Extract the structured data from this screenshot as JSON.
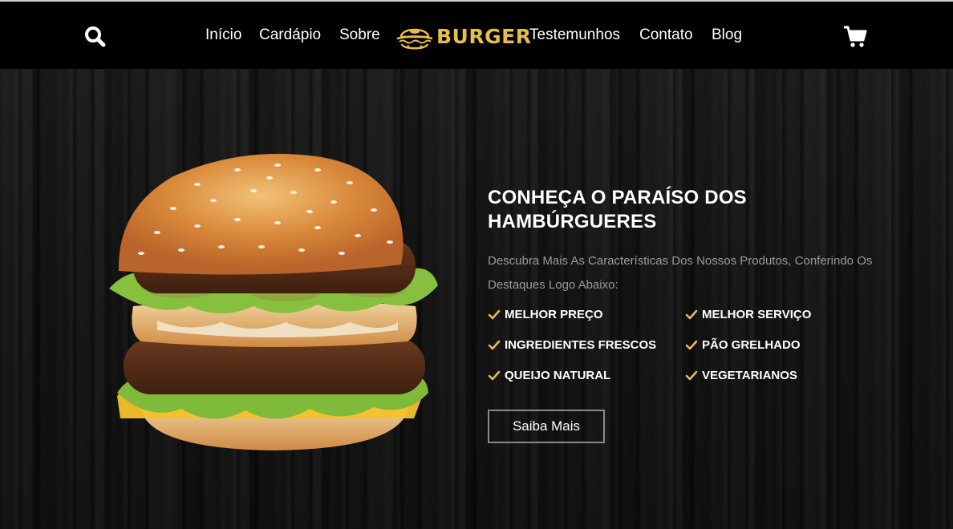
{
  "nav": {
    "links": [
      "Início",
      "Cardápio",
      "Sobre",
      "Testemunhos",
      "Contato",
      "Blog"
    ],
    "logo_text": "BURGER",
    "search_icon": "search-icon",
    "cart_icon": "cart-icon"
  },
  "hero": {
    "title_line1": "CONHEÇA O PARAÍSO DOS",
    "title_line2": "HAMBÚRGUERES",
    "description": "Descubra Mais As Características Dos Nossos Produtos, Conferindo Os Destaques Logo Abaixo:",
    "features": [
      "MELHOR PREÇO",
      "MELHOR SERVIÇO",
      "INGREDIENTES FRESCOS",
      "PÃO GRELHADO",
      "QUEIJO NATURAL",
      "VEGETARIANOS"
    ],
    "cta_label": "Saiba Mais"
  },
  "colors": {
    "accent": "#e8bc4a",
    "background": "#000000",
    "text": "#ffffff"
  }
}
